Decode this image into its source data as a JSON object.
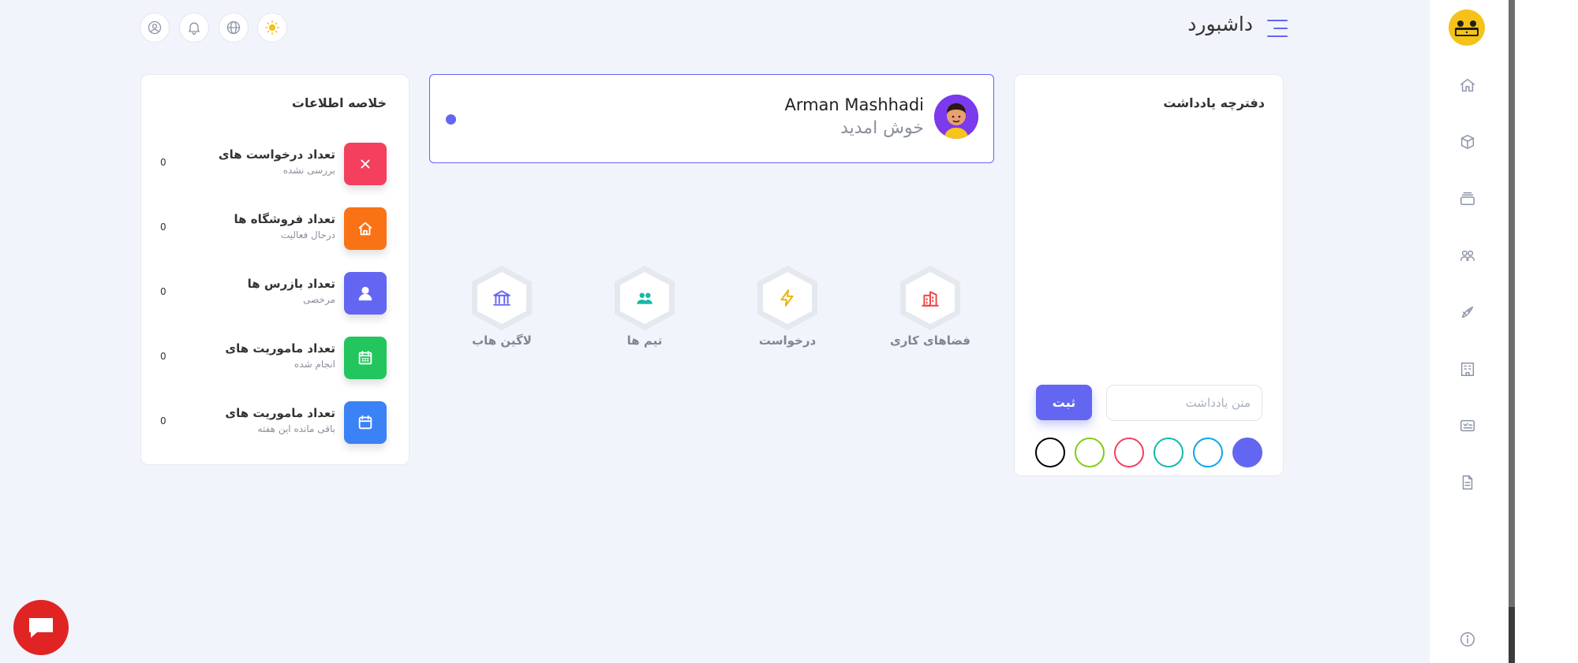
{
  "header": {
    "title": "داشبورد",
    "icons": [
      "menu-icon",
      "sun-icon",
      "globe-icon",
      "bell-icon",
      "user-circle-icon"
    ]
  },
  "sidebar": {
    "logo_icon": "team-logo",
    "items": [
      "home-icon",
      "box-icon",
      "stack-icon",
      "users-icon",
      "rocket-icon",
      "building-icon",
      "task-icon",
      "document-icon"
    ],
    "bottom_icon": "info-icon"
  },
  "notebook": {
    "title": "دفترچه یادداشت",
    "input_placeholder": "متن یادداشت",
    "submit_label": "ثبت",
    "colors": [
      "#6366f1",
      "#0ea5e9",
      "#14b8a6",
      "#f43f5e",
      "#84cc16",
      "#000000"
    ]
  },
  "welcome": {
    "name": "Arman Mashhadi",
    "greeting": "خوش امدید",
    "status_color": "#6366f1"
  },
  "shortcuts": [
    {
      "label": "فضاهای کاری",
      "icon": "building-icon",
      "color": "#ef4444"
    },
    {
      "label": "درخواست",
      "icon": "bolt-icon",
      "color": "#eab308"
    },
    {
      "label": "تیم ها",
      "icon": "team-icon",
      "color": "#14b8a6"
    },
    {
      "label": "لاگین هاب",
      "icon": "bank-icon",
      "color": "#6366f1"
    }
  ],
  "summary": {
    "title": "خلاصه اطلاعات",
    "stats": [
      {
        "title": "تعداد درخواست های",
        "subtitle": "بررسی نشده",
        "value": "0",
        "icon": "close-icon",
        "color": "#f43f5e"
      },
      {
        "title": "تعداد فروشگاه ها",
        "subtitle": "درحال فعالیت",
        "value": "0",
        "icon": "store-icon",
        "color": "#f97316"
      },
      {
        "title": "تعداد بازرس ها",
        "subtitle": "مرخصی",
        "value": "0",
        "icon": "person-icon",
        "color": "#6366f1"
      },
      {
        "title": "تعداد ماموریت های",
        "subtitle": "انجام شده",
        "value": "0",
        "icon": "calendar-grid-icon",
        "color": "#22c55e"
      },
      {
        "title": "تعداد ماموریت های",
        "subtitle": "باقی مانده این هفته",
        "value": "0",
        "icon": "calendar-icon",
        "color": "#3b82f6"
      }
    ]
  },
  "chat": {
    "icon": "chat-icon",
    "color": "#e02424"
  }
}
